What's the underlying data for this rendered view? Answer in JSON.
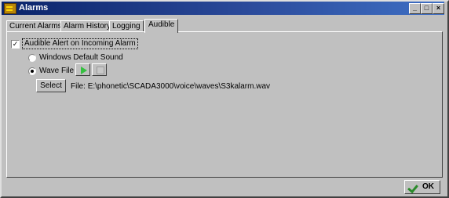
{
  "window": {
    "title": "Alarms",
    "controls": {
      "minimize": "_",
      "maximize": "□",
      "close": "×"
    }
  },
  "tabs": [
    {
      "label": "Current Alarms",
      "active": false
    },
    {
      "label": "Alarm History",
      "active": false
    },
    {
      "label": "Logging",
      "active": false
    },
    {
      "label": "Audible",
      "active": true
    }
  ],
  "audible": {
    "checkbox_label": "Audible Alert on Incoming Alarm",
    "checkbox_checked": true,
    "checkbox_mark": "✓",
    "option_default": "Windows Default Sound",
    "option_wave": "Wave File",
    "selected_option": "wave",
    "select_button": "Select",
    "file_label": "File:",
    "file_path": "E:\\phonetic\\SCADA3000\\voice\\waves\\S3kalarm.wav"
  },
  "footer": {
    "ok_button": "OK"
  },
  "icons": {
    "play": "play-icon",
    "stop": "stop-icon",
    "ok": "check-icon"
  },
  "colors": {
    "titlebar": "#0a246a",
    "play": "#35c040",
    "check": "#2a8a2a"
  }
}
